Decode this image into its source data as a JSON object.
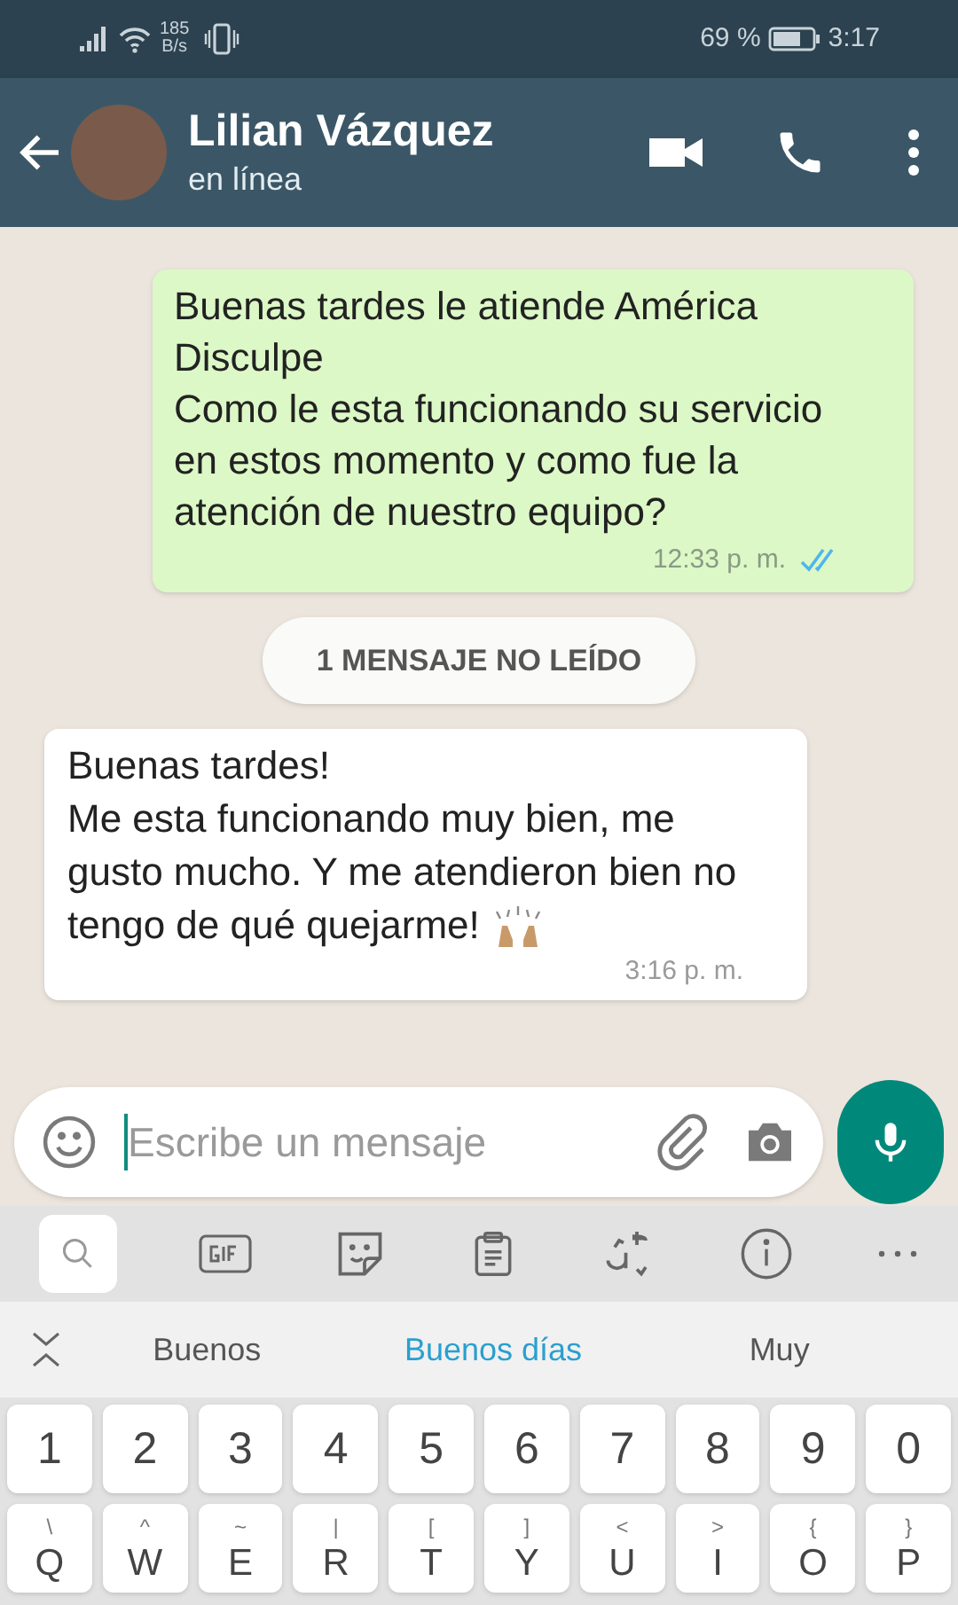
{
  "status_bar": {
    "speed_value": "185",
    "speed_unit": "B/s",
    "battery_percent": "69 %",
    "time": "3:17"
  },
  "header": {
    "name": "Lilian Vázquez",
    "status": "en línea"
  },
  "messages": [
    {
      "kind": "outgoing",
      "lines": [
        "Buenas tardes le atiende América",
        "Disculpe",
        "Como le esta funcionando su servicio en estos momento y como fue la atención de nuestro equipo?"
      ],
      "time": "12:33 p. m.",
      "read": true
    },
    {
      "kind": "unread_banner",
      "lines": [
        "1 MENSAJE NO LEÍDO"
      ]
    },
    {
      "kind": "incoming",
      "lines": [
        "Buenas tardes!",
        "Me esta funcionando muy bien, me gusto mucho. Y me atendieron bien no tengo de qué quejarme!"
      ],
      "time": "3:16 p. m."
    }
  ],
  "composer": {
    "placeholder": "Escribe un mensaje"
  },
  "keyboard": {
    "suggestions": [
      {
        "text": "Buenos",
        "selected": false
      },
      {
        "text": "Buenos días",
        "selected": true
      },
      {
        "text": "Muy",
        "selected": false
      }
    ],
    "rows": [
      [
        {
          "main": "1"
        },
        {
          "main": "2"
        },
        {
          "main": "3"
        },
        {
          "main": "4"
        },
        {
          "main": "5"
        },
        {
          "main": "6"
        },
        {
          "main": "7"
        },
        {
          "main": "8"
        },
        {
          "main": "9"
        },
        {
          "main": "0"
        }
      ],
      [
        {
          "main": "Q",
          "alt": "\\"
        },
        {
          "main": "W",
          "alt": "^"
        },
        {
          "main": "E",
          "alt": "~"
        },
        {
          "main": "R",
          "alt": "|"
        },
        {
          "main": "T",
          "alt": "["
        },
        {
          "main": "Y",
          "alt": "]"
        },
        {
          "main": "U",
          "alt": "<"
        },
        {
          "main": "I",
          "alt": ">"
        },
        {
          "main": "O",
          "alt": "{"
        },
        {
          "main": "P",
          "alt": "}"
        }
      ]
    ]
  }
}
